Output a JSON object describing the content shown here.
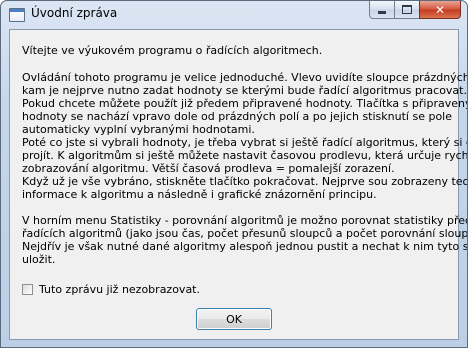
{
  "window": {
    "title": "Úvodní zpráva",
    "icon": "application-window-icon",
    "caption_buttons": [
      "minimize-icon",
      "maximize-icon",
      "close-icon"
    ],
    "close_glyph": "✕"
  },
  "message": {
    "intro": "Vítejte ve výukovém programu o řadících algoritmech.",
    "paragraphs": [
      [
        "Ovládání tohoto programu je velice jednoduché. Vlevo uvidíte sloupce prázdných polí",
        "kam je nejprve nutno zadat hodnoty se kterými bude řadící algoritmus pracovat.",
        "Pokud chcete můžete použít již předem připravené hodnoty. Tlačítka s připravenými",
        "hodnoty se nachází vpravo dole od prázdných polí a po jejich stisknutí se pole",
        "automaticky vyplní vybranými hodnotami.",
        "Poté co jste si vybrali hodnoty, je třeba vybrat si ještě řadící algoritmus, který si chcete",
        "projít. K algoritmům si ještě můžete nastavit časovou prodlevu, která určuje rychlost",
        "zobrazování algoritmu. Větší časová prodleva = pomalejší zorazení.",
        "Když už je vše vybráno, stiskněte tlačítko pokračovat. Nejprve sou zobrazeny teoretické",
        "informace k algoritmu a následně i grafické znázornění principu."
      ],
      [
        "V horním menu Statistiky - porovnání algoritmů je možno porovnat statistiky předváděních",
        "řadících algoritmů (jako jsou čas, počet přesunů sloupců a počet porovnání sloupců).",
        "Nejdřív je však nutné dané algoritmy alespoň jednou pustit a nechat k nim tyto statistiky",
        "uložit."
      ]
    ]
  },
  "dont_show_checkbox": {
    "label": "Tuto zprávu již nezobrazovat.",
    "checked": false
  },
  "ok_button": {
    "label": "OK"
  }
}
